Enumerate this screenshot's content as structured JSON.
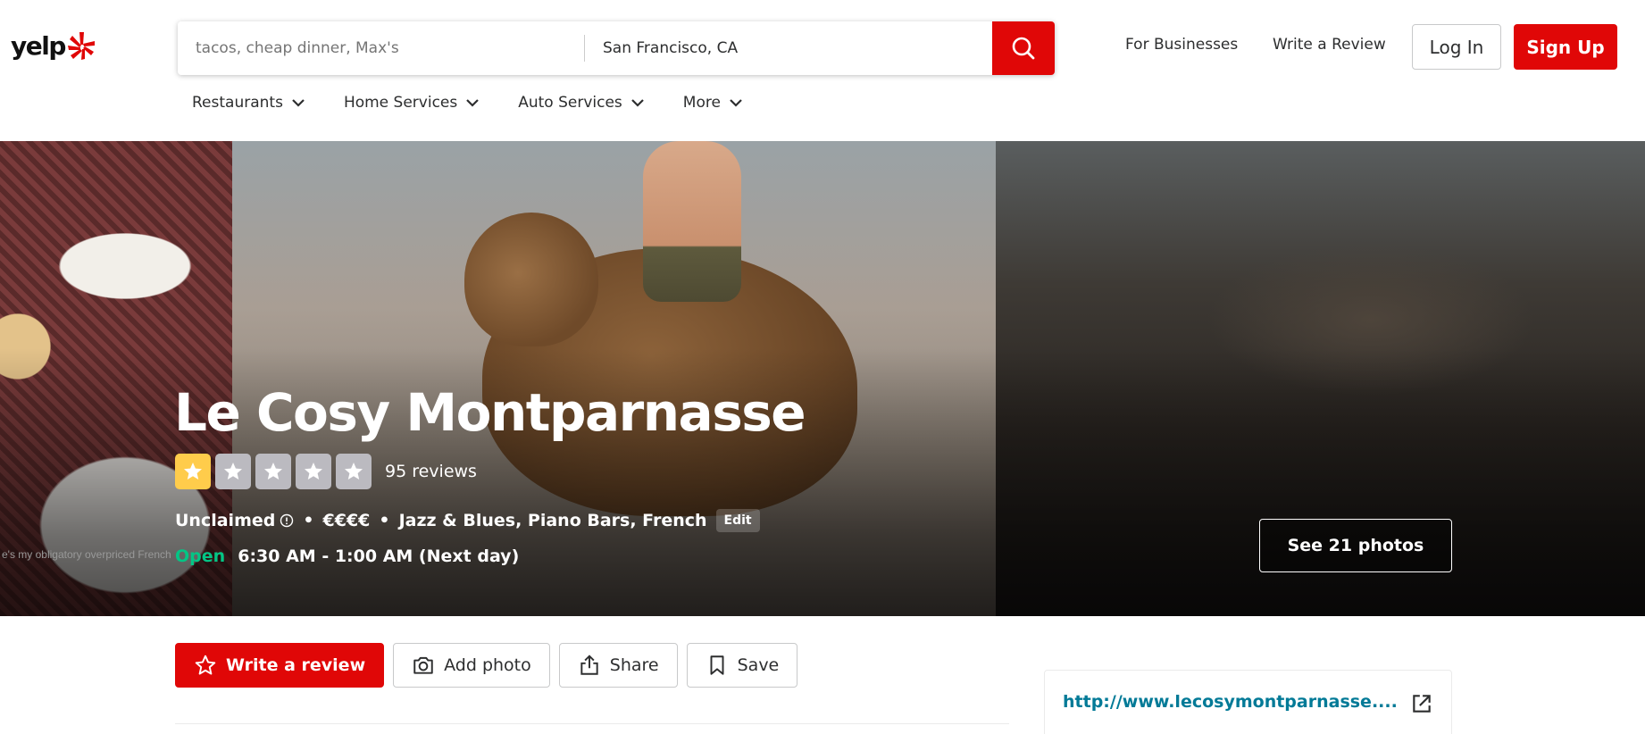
{
  "header": {
    "logo_text": "yelp",
    "search_find_placeholder": "tacos, cheap dinner, Max's",
    "search_near_value": "San Francisco, CA",
    "for_businesses": "For Businesses",
    "write_a_review": "Write a Review",
    "log_in": "Log In",
    "sign_up": "Sign Up"
  },
  "nav": {
    "items": [
      {
        "label": "Restaurants"
      },
      {
        "label": "Home Services"
      },
      {
        "label": "Auto Services"
      },
      {
        "label": "More"
      }
    ]
  },
  "business": {
    "name": "Le Cosy Montparnasse",
    "rating": 1,
    "max_rating": 5,
    "reviews_count": "95 reviews",
    "claim_status": "Unclaimed",
    "price": "€€€€",
    "categories": "Jazz & Blues, Piano Bars, French",
    "edit_label": "Edit",
    "open_status": "Open",
    "hours": "6:30 AM - 1:00 AM (Next day)",
    "see_photos": "See 21 photos",
    "photo_caption": "e's my obligatory overpriced French"
  },
  "actions": {
    "write_review": "Write a review",
    "add_photo": "Add photo",
    "share": "Share",
    "save": "Save"
  },
  "sidebar": {
    "website": "http://www.lecosymontparnasse...."
  },
  "colors": {
    "brand_red": "#e00707",
    "star_yellow": "#ffcc4b",
    "open_green": "#04c585",
    "link_teal": "#027a97"
  },
  "icons": [
    "yelp-burst-icon",
    "search-icon",
    "chevron-down-icon",
    "star-icon",
    "info-icon",
    "camera-icon",
    "share-icon",
    "bookmark-icon",
    "external-link-icon"
  ]
}
